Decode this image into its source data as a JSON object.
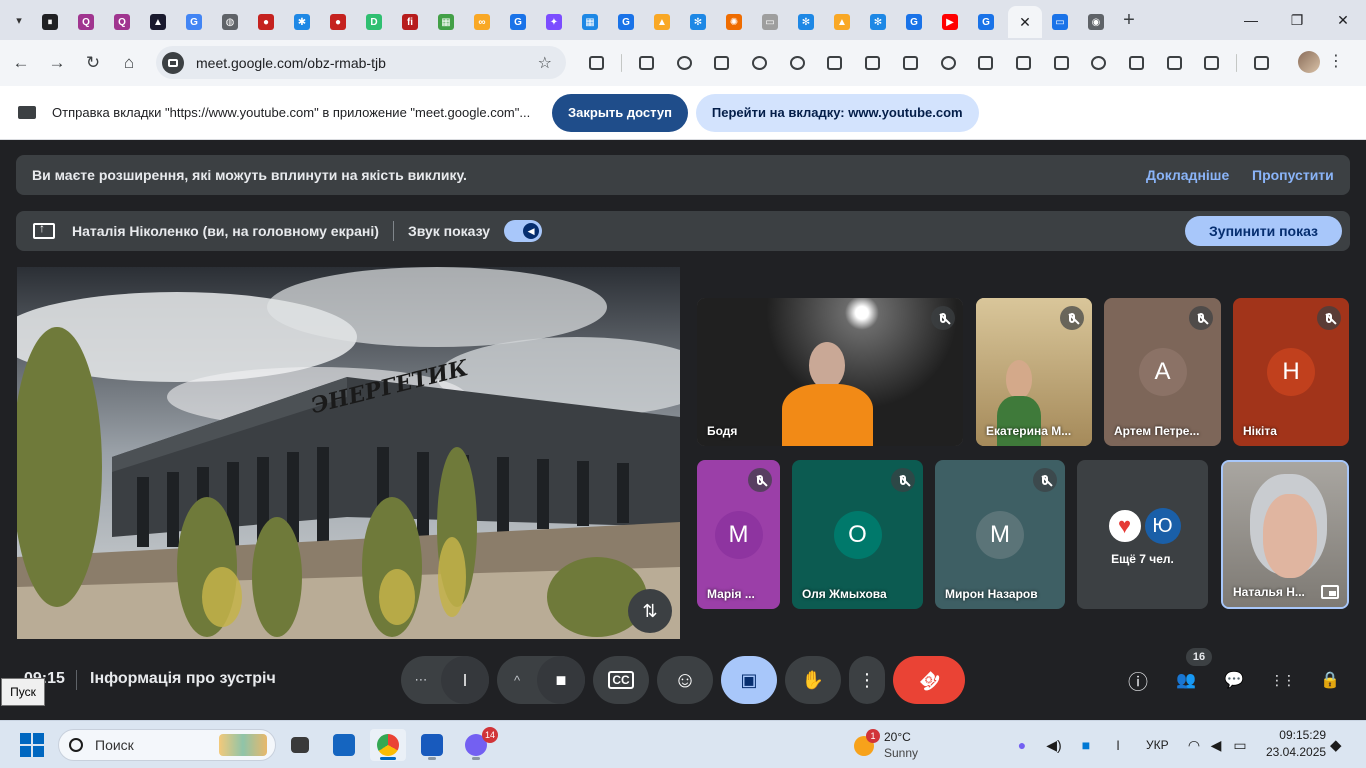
{
  "browser": {
    "tabs": [
      {
        "icon": "media-icon",
        "color": "#202124",
        "glyph": "⏸"
      },
      {
        "icon": "q-icon",
        "color": "#a0358f",
        "glyph": "Q"
      },
      {
        "icon": "q-icon",
        "color": "#a0358f",
        "glyph": "Q"
      },
      {
        "icon": "triangle-icon",
        "color": "#1a1a2e",
        "glyph": "▲"
      },
      {
        "icon": "google-icon",
        "color": "#4285f4",
        "glyph": "G"
      },
      {
        "icon": "globe-icon",
        "color": "#5f6368",
        "glyph": "◍"
      },
      {
        "icon": "ball-icon",
        "color": "#c5221f",
        "glyph": "●"
      },
      {
        "icon": "puzzle-icon",
        "color": "#1e88e5",
        "glyph": "✱"
      },
      {
        "icon": "ball-icon",
        "color": "#c5221f",
        "glyph": "●"
      },
      {
        "icon": "d-icon",
        "color": "#2fbf71",
        "glyph": "D"
      },
      {
        "icon": "fi-icon",
        "color": "#b71c1c",
        "glyph": "fi"
      },
      {
        "icon": "grid-icon",
        "color": "#43a047",
        "glyph": "▦"
      },
      {
        "icon": "link-icon",
        "color": "#f9a825",
        "glyph": "∞"
      },
      {
        "icon": "docs-icon",
        "color": "#1a73e8",
        "glyph": "G"
      },
      {
        "icon": "chat-icon",
        "color": "#7c4dff",
        "glyph": "✦"
      },
      {
        "icon": "tiles-icon",
        "color": "#1e88e5",
        "glyph": "▦"
      },
      {
        "icon": "docs-icon",
        "color": "#1a73e8",
        "glyph": "G"
      },
      {
        "icon": "bell-icon",
        "color": "#f9a825",
        "glyph": "▲"
      },
      {
        "icon": "snowflake-icon",
        "color": "#1e88e5",
        "glyph": "✻"
      },
      {
        "icon": "pinwheel-icon",
        "color": "#ef6c00",
        "glyph": "✺"
      },
      {
        "icon": "board-icon",
        "color": "#9e9e9e",
        "glyph": "▭"
      },
      {
        "icon": "snowflake-icon",
        "color": "#1e88e5",
        "glyph": "✻"
      },
      {
        "icon": "bell-icon",
        "color": "#f9a825",
        "glyph": "▲"
      },
      {
        "icon": "snowflake-icon",
        "color": "#1e88e5",
        "glyph": "✻"
      },
      {
        "icon": "docs-icon",
        "color": "#1a73e8",
        "glyph": "G"
      },
      {
        "icon": "youtube-icon",
        "color": "#ff0000",
        "glyph": "▶"
      },
      {
        "icon": "docs-icon",
        "color": "#1a73e8",
        "glyph": "G"
      }
    ],
    "active_tab_close": "✕",
    "after_tabs": [
      {
        "icon": "meet-tab-icon",
        "color": "#1a73e8",
        "glyph": "▭"
      },
      {
        "icon": "chrome-icon",
        "color": "#5f6368",
        "glyph": "◉"
      }
    ],
    "new_tab": "+",
    "window_controls": {
      "minimize": "—",
      "maximize": "❐",
      "close": "✕"
    },
    "address": "meet.google.com/obz-rmab-tjb",
    "nav": {
      "back": "←",
      "forward": "→",
      "reload": "↻",
      "home": "⌂",
      "star": "☆",
      "menu": "⋮"
    }
  },
  "infobar": {
    "text": "Отправка вкладки \"https://www.youtube.com\" в приложение \"meet.google.com\"...",
    "stop_access": "Закрыть доступ",
    "switch_tab": "Перейти на вкладку: www.youtube.com"
  },
  "meet": {
    "warning": {
      "text": "Ви маєте розширення, які можуть вплинути на якість виклику.",
      "learn_more": "Докладніше",
      "skip": "Пропустити"
    },
    "sharebar": {
      "presenter": "Наталія Ніколенко (ви, на головному екрані)",
      "audio_label": "Звук показу",
      "stop": "Зупинити показ"
    },
    "presentation": {
      "sign": "ЭНЕРГЕТИК"
    },
    "tiles": [
      {
        "name": "Бодя",
        "type": "video",
        "bg": "#5a5a5a"
      },
      {
        "name": "Екатерина М...",
        "type": "video",
        "bg": "#b09a6c"
      },
      {
        "name": "Артем Петре...",
        "type": "avatar",
        "initial": "А",
        "bg": "#7d6659",
        "avatar_bg": "#8b7266"
      },
      {
        "name": "Нікіта",
        "type": "avatar",
        "initial": "Н",
        "bg": "#a2341a",
        "avatar_bg": "#c1401d"
      },
      {
        "name": "Марія ...",
        "type": "avatar",
        "initial": "М",
        "bg": "#9b3fa8",
        "avatar_bg": "#8e34a0"
      },
      {
        "name": "Оля Жмыхова",
        "type": "avatar",
        "initial": "О",
        "bg": "#0c5b51",
        "avatar_bg": "#00796b"
      },
      {
        "name": "Мирон Назаров",
        "type": "avatar",
        "initial": "М",
        "bg": "#3e5f64",
        "avatar_bg": "#5b7478"
      },
      {
        "name": "Ещё 7 чел.",
        "type": "more",
        "initial": "Ю",
        "bg": "#3c4043",
        "avatar_bg": "#1a5fa8"
      },
      {
        "name": "Наталья Н...",
        "type": "self",
        "bg": "#8d8a86"
      }
    ],
    "time": "09:15",
    "meeting_info": "Інформація про зустріч",
    "participants_count": "16",
    "controls": {
      "more": "⋯",
      "chevron": "^",
      "mic": "🎤",
      "camera": "📹",
      "captions": "CC",
      "emoji": "☺",
      "present": "▣",
      "hand": "✋",
      "options": "⋮",
      "end": "☎"
    },
    "right_controls": {
      "info": "ⓘ",
      "people": "👥",
      "chat": "💬",
      "activities": "⋮⋮",
      "host": "🔒"
    }
  },
  "tooltip": "Пуск",
  "taskbar": {
    "search_placeholder": "Поиск",
    "chat_badge": "14",
    "weather": {
      "temp": "20°C",
      "condition": "Sunny",
      "badge": "1"
    },
    "lang": "УКР",
    "time": "09:15:29",
    "date": "23.04.2025"
  }
}
